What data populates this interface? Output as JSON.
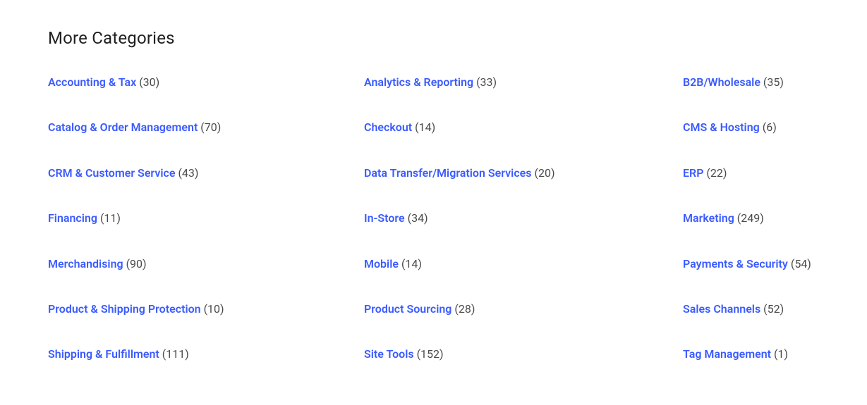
{
  "heading": "More Categories",
  "categories": [
    {
      "label": "Accounting & Tax",
      "count": 30
    },
    {
      "label": "Analytics & Reporting",
      "count": 33
    },
    {
      "label": "B2B/Wholesale",
      "count": 35
    },
    {
      "label": "Catalog & Order Management",
      "count": 70
    },
    {
      "label": "Checkout",
      "count": 14
    },
    {
      "label": "CMS & Hosting",
      "count": 6
    },
    {
      "label": "CRM & Customer Service",
      "count": 43
    },
    {
      "label": "Data Transfer/Migration Services",
      "count": 20
    },
    {
      "label": "ERP",
      "count": 22
    },
    {
      "label": "Financing",
      "count": 11
    },
    {
      "label": "In-Store",
      "count": 34
    },
    {
      "label": "Marketing",
      "count": 249
    },
    {
      "label": "Merchandising",
      "count": 90
    },
    {
      "label": "Mobile",
      "count": 14
    },
    {
      "label": "Payments & Security",
      "count": 54
    },
    {
      "label": "Product & Shipping Protection",
      "count": 10
    },
    {
      "label": "Product Sourcing",
      "count": 28
    },
    {
      "label": "Sales Channels",
      "count": 52
    },
    {
      "label": "Shipping & Fulfillment",
      "count": 111
    },
    {
      "label": "Site Tools",
      "count": 152
    },
    {
      "label": "Tag Management",
      "count": 1
    }
  ]
}
